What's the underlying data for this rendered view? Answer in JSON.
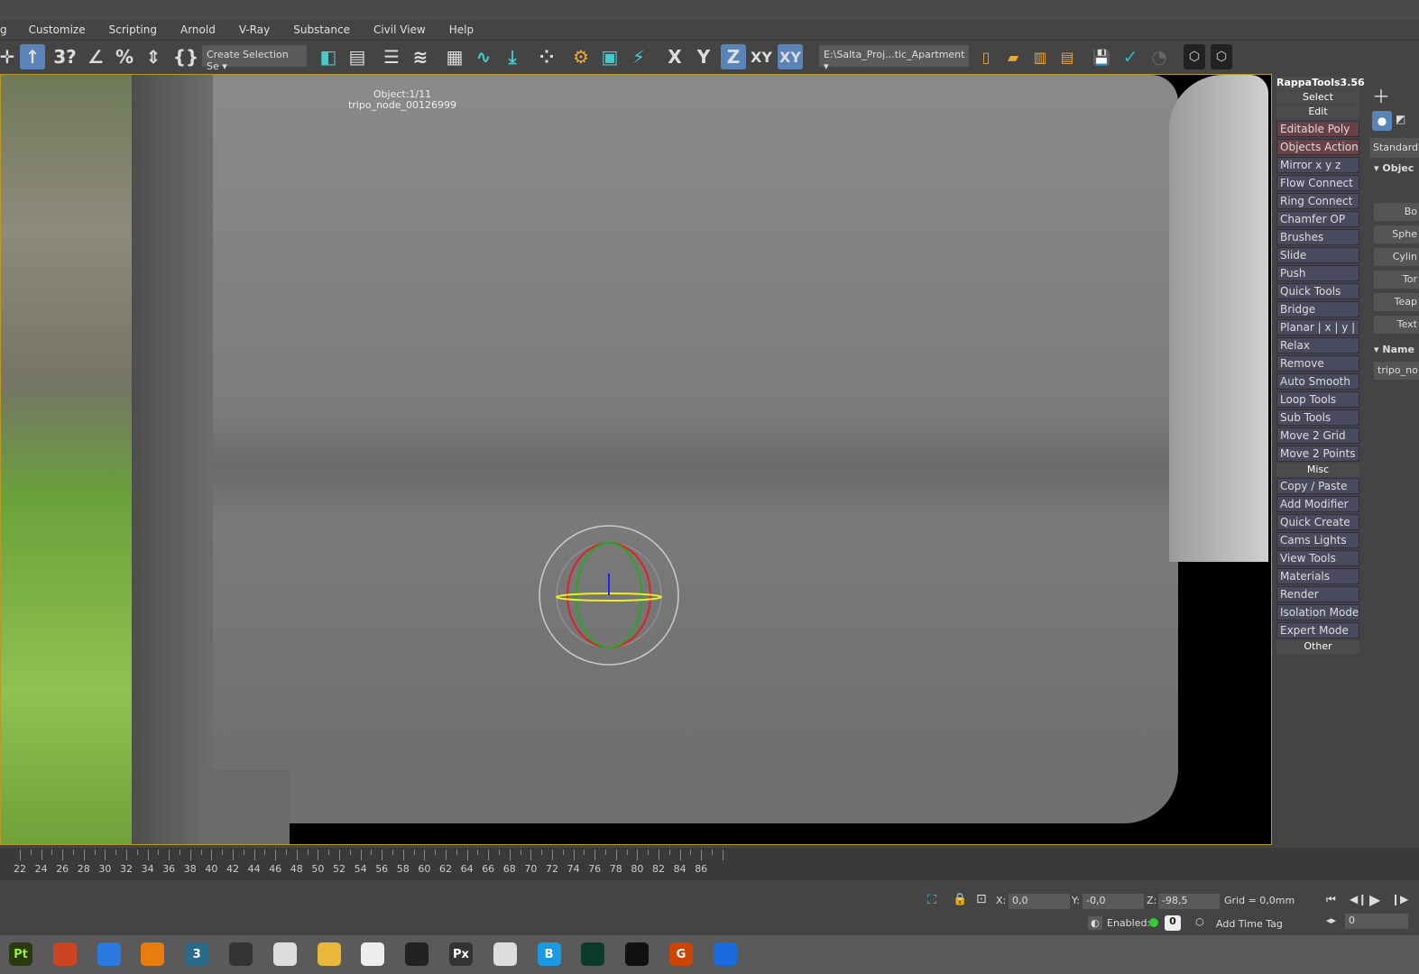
{
  "menu": [
    "g",
    "Customize",
    "Scripting",
    "Arnold",
    "V-Ray",
    "Substance",
    "Civil View",
    "Help"
  ],
  "toolbar": {
    "selection_set": "Create Selection Se",
    "project_path": "E:\\Salta_Proj...tic_Apartment",
    "axis_x": "X",
    "axis_y": "Y",
    "axis_z": "Z",
    "axis_xy": "XY",
    "axis_xy2": "XY"
  },
  "viewport": {
    "object_count": "Object:1/11",
    "object_name": "tripo_node_00126999"
  },
  "rappa": {
    "title": "RappaTools3.56",
    "select": "Select",
    "edit": "Edit",
    "misc": "Misc",
    "other": "Other",
    "buttons": [
      "Editable Poly",
      "Objects Actions",
      "Mirror   x  y  z",
      "Flow Connect",
      "Ring Connect",
      "Chamfer OP",
      "Brushes",
      "Slide",
      "Push",
      "Quick Tools",
      "Bridge",
      "Planar | x | y | z",
      "Relax",
      "Remove",
      "Auto Smooth",
      "Loop Tools",
      "Sub Tools",
      "Move 2 Grid",
      "Move 2 Points"
    ],
    "misc_buttons": [
      "Copy / Paste",
      "Add Modifier",
      "Quick Create",
      "Cams Lights",
      "View Tools",
      "Materials",
      "Render",
      "Isolation Mode",
      "Expert Mode"
    ]
  },
  "command_panel": {
    "category": "Standard",
    "rollout_object": "Objec",
    "objects": [
      "Bo",
      "Sphe",
      "Cylin",
      "Tor",
      "Teap",
      "Text"
    ],
    "rollout_name": "Name",
    "name_value": "tripo_no"
  },
  "timeline": {
    "ticks": [
      "22",
      "24",
      "26",
      "28",
      "30",
      "32",
      "34",
      "36",
      "38",
      "40",
      "42",
      "44",
      "46",
      "48",
      "50",
      "52",
      "54",
      "56",
      "58",
      "60",
      "62",
      "64",
      "66",
      "68",
      "70",
      "72",
      "74",
      "76",
      "78",
      "80",
      "82",
      "84",
      "86"
    ]
  },
  "status": {
    "x_label": "X:",
    "x": "0,0",
    "y_label": "Y:",
    "y": "-0,0",
    "z_label": "Z:",
    "z": "-98,5",
    "grid": "Grid = 0,0mm",
    "enabled": "Enabled:",
    "enabled_count": "0",
    "add_time_tag": "Add Time Tag",
    "frame": "0"
  },
  "taskbar": [
    "Pt",
    "",
    "",
    "",
    "3",
    "",
    "",
    "",
    "",
    "",
    "Px",
    "",
    "B",
    "",
    "",
    "G",
    ""
  ],
  "colors": {
    "accent": "#5a84b8",
    "rappa_highlight": "#6a4048",
    "viewport_border": "#b79a2a"
  }
}
